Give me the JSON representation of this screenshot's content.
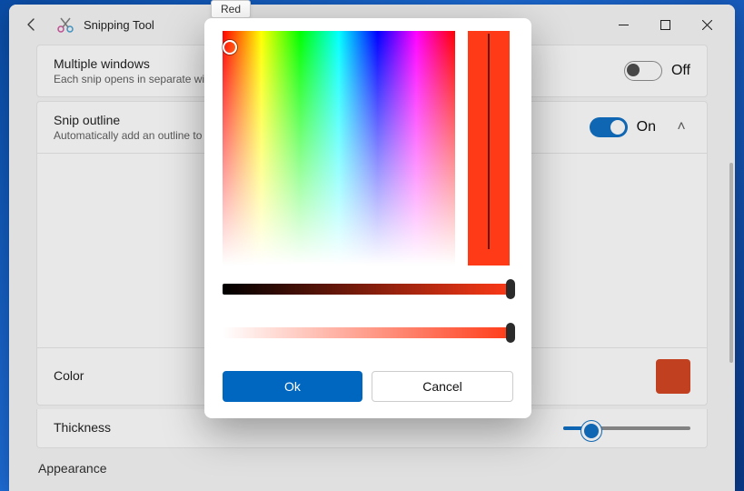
{
  "tooltip": "Red",
  "app": {
    "title": "Snipping Tool"
  },
  "settings": {
    "multi": {
      "title": "Multiple windows",
      "sub": "Each snip opens in separate wi",
      "state": "Off"
    },
    "outline": {
      "title": "Snip outline",
      "sub": "Automatically add an outline to",
      "state": "On"
    },
    "color_label": "Color",
    "thickness_label": "Thickness",
    "appearance_label": "Appearance",
    "colors": {
      "swatch": "#d23a13"
    }
  },
  "modal": {
    "ok": "Ok",
    "cancel": "Cancel",
    "selected_color": "#ff3a17"
  },
  "icons": {
    "chev_up": "˄"
  }
}
